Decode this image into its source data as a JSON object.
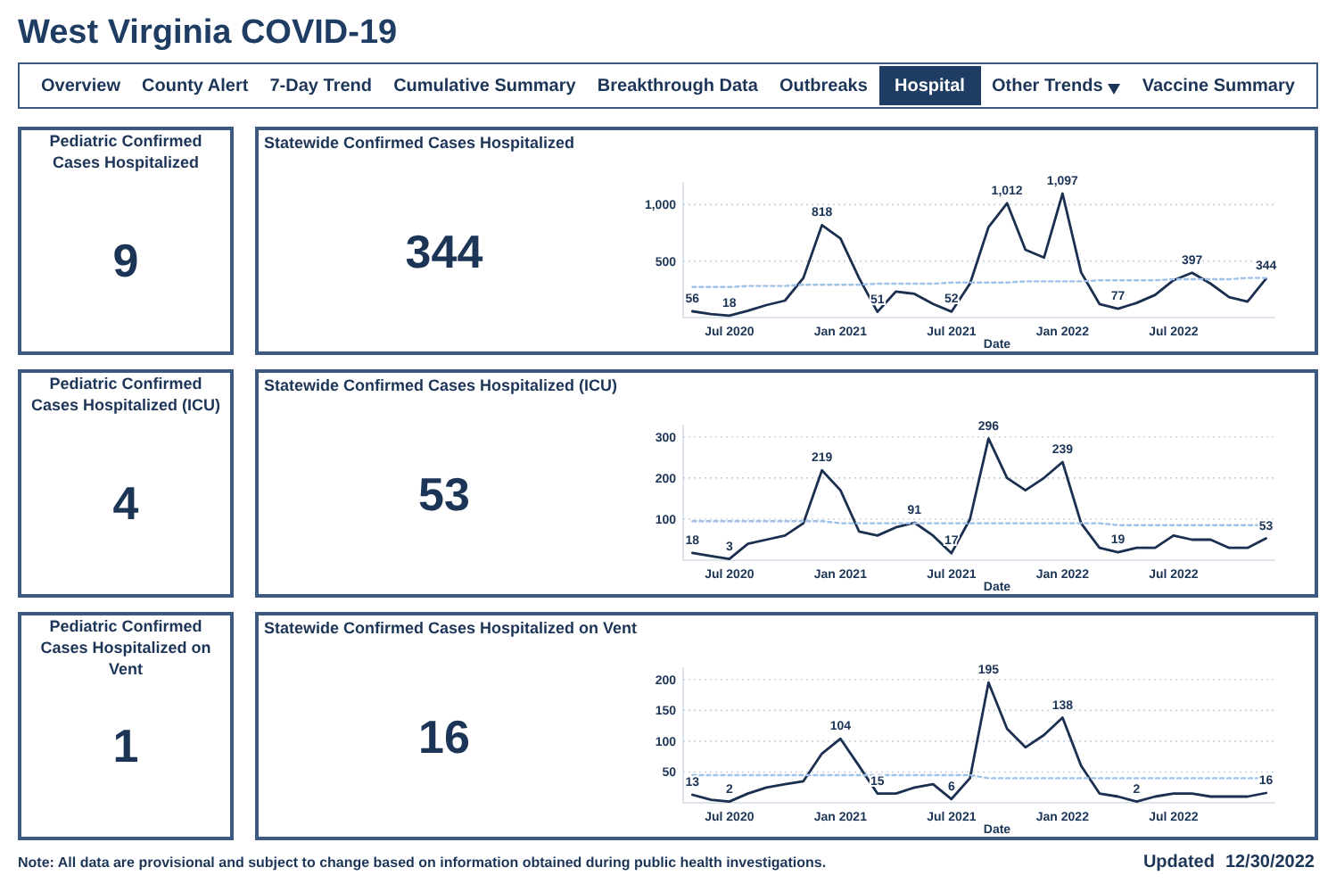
{
  "title": "West Virginia COVID-19",
  "nav": [
    {
      "label": "Overview",
      "selected": false,
      "dropdown": false
    },
    {
      "label": "County Alert",
      "selected": false,
      "dropdown": false
    },
    {
      "label": "7-Day Trend",
      "selected": false,
      "dropdown": false
    },
    {
      "label": "Cumulative Summary",
      "selected": false,
      "dropdown": false
    },
    {
      "label": "Breakthrough Data",
      "selected": false,
      "dropdown": false
    },
    {
      "label": "Outbreaks",
      "selected": false,
      "dropdown": false
    },
    {
      "label": "Hospital",
      "selected": true,
      "dropdown": false
    },
    {
      "label": "Other Trends",
      "selected": false,
      "dropdown": true
    },
    {
      "label": "Vaccine Summary",
      "selected": false,
      "dropdown": false
    }
  ],
  "rows": [
    {
      "pediatric": {
        "label": "Pediatric Confirmed Cases Hospitalized",
        "value": "9"
      },
      "statewide": {
        "label": "Statewide Confirmed Cases Hospitalized",
        "value": "344",
        "chart_data": {
          "type": "line",
          "xlabel": "Date",
          "grid": true,
          "categories": [
            null,
            null,
            "Jul 2020",
            null,
            null,
            null,
            null,
            null,
            "Jan 2021",
            null,
            null,
            null,
            null,
            null,
            "Jul 2021",
            null,
            null,
            null,
            null,
            null,
            "Jan 2022",
            null,
            null,
            null,
            null,
            null,
            "Jul 2022",
            null,
            null,
            null,
            null,
            null
          ],
          "ylim": [
            0,
            1200
          ],
          "yticks": [
            {
              "value": 500,
              "label": "500"
            },
            {
              "value": 1000,
              "label": "1,000"
            }
          ],
          "series": [
            {
              "color": "#1b2f50",
              "line_style": "solid",
              "values": [
                56,
                30,
                18,
                60,
                110,
                150,
                350,
                818,
                700,
                350,
                51,
                230,
                210,
                120,
                52,
                300,
                800,
                1012,
                600,
                530,
                1097,
                400,
                120,
                77,
                130,
                200,
                330,
                397,
                300,
                180,
                140,
                344
              ],
              "value_labels": [
                "56",
                null,
                "18",
                null,
                null,
                null,
                null,
                "818",
                null,
                null,
                "51",
                null,
                null,
                null,
                "52",
                null,
                null,
                "1,012",
                null,
                null,
                "1,097",
                null,
                null,
                "77",
                null,
                null,
                null,
                "397",
                null,
                null,
                null,
                "344"
              ]
            },
            {
              "color": "#9fc0e8",
              "line_style": "dashed",
              "values": [
                270,
                270,
                270,
                280,
                280,
                280,
                290,
                290,
                290,
                290,
                300,
                300,
                300,
                300,
                310,
                310,
                310,
                310,
                320,
                320,
                320,
                320,
                330,
                330,
                330,
                330,
                340,
                340,
                340,
                340,
                350,
                350
              ]
            }
          ]
        }
      }
    },
    {
      "pediatric": {
        "label": "Pediatric Confirmed Cases Hospitalized (ICU)",
        "value": "4"
      },
      "statewide": {
        "label": "Statewide Confirmed Cases Hospitalized (ICU)",
        "value": "53",
        "chart_data": {
          "type": "line",
          "xlabel": "Date",
          "grid": true,
          "categories": [
            null,
            null,
            "Jul 2020",
            null,
            null,
            null,
            null,
            null,
            "Jan 2021",
            null,
            null,
            null,
            null,
            null,
            "Jul 2021",
            null,
            null,
            null,
            null,
            null,
            "Jan 2022",
            null,
            null,
            null,
            null,
            null,
            "Jul 2022",
            null,
            null,
            null,
            null,
            null
          ],
          "ylim": [
            0,
            330
          ],
          "yticks": [
            {
              "value": 100,
              "label": "100"
            },
            {
              "value": 200,
              "label": "200"
            },
            {
              "value": 300,
              "label": "300"
            }
          ],
          "series": [
            {
              "color": "#1b2f50",
              "line_style": "solid",
              "values": [
                18,
                10,
                3,
                40,
                50,
                60,
                90,
                219,
                170,
                70,
                60,
                80,
                91,
                60,
                17,
                100,
                296,
                200,
                170,
                200,
                239,
                90,
                30,
                19,
                30,
                30,
                60,
                50,
                50,
                30,
                30,
                53
              ],
              "value_labels": [
                "18",
                null,
                "3",
                null,
                null,
                null,
                null,
                "219",
                null,
                null,
                null,
                null,
                "91",
                null,
                "17",
                null,
                "296",
                null,
                null,
                null,
                "239",
                null,
                null,
                "19",
                null,
                null,
                null,
                null,
                null,
                null,
                null,
                "53"
              ]
            },
            {
              "color": "#9fc0e8",
              "line_style": "dashed",
              "values": [
                95,
                95,
                95,
                95,
                95,
                95,
                95,
                95,
                90,
                90,
                90,
                90,
                90,
                90,
                90,
                90,
                90,
                90,
                90,
                90,
                90,
                90,
                90,
                85,
                85,
                85,
                85,
                85,
                85,
                85,
                85,
                85
              ]
            }
          ]
        }
      }
    },
    {
      "pediatric": {
        "label": "Pediatric Confirmed Cases Hospitalized on Vent",
        "value": "1"
      },
      "statewide": {
        "label": "Statewide Confirmed Cases Hospitalized on Vent",
        "value": "16",
        "chart_data": {
          "type": "line",
          "xlabel": "Date",
          "grid": true,
          "categories": [
            null,
            null,
            "Jul 2020",
            null,
            null,
            null,
            null,
            null,
            "Jan 2021",
            null,
            null,
            null,
            null,
            null,
            "Jul 2021",
            null,
            null,
            null,
            null,
            null,
            "Jan 2022",
            null,
            null,
            null,
            null,
            null,
            "Jul 2022",
            null,
            null,
            null,
            null,
            null
          ],
          "ylim": [
            0,
            220
          ],
          "yticks": [
            {
              "value": 50,
              "label": "50"
            },
            {
              "value": 100,
              "label": "100"
            },
            {
              "value": 150,
              "label": "150"
            },
            {
              "value": 200,
              "label": "200"
            }
          ],
          "series": [
            {
              "color": "#1b2f50",
              "line_style": "solid",
              "values": [
                13,
                5,
                2,
                15,
                25,
                30,
                35,
                80,
                104,
                60,
                15,
                15,
                25,
                30,
                6,
                40,
                195,
                120,
                90,
                110,
                138,
                60,
                15,
                10,
                2,
                10,
                15,
                15,
                10,
                10,
                10,
                16
              ],
              "value_labels": [
                "13",
                null,
                "2",
                null,
                null,
                null,
                null,
                null,
                "104",
                null,
                "15",
                null,
                null,
                null,
                "6",
                null,
                "195",
                null,
                null,
                null,
                "138",
                null,
                null,
                null,
                "2",
                null,
                null,
                null,
                null,
                null,
                null,
                "16"
              ]
            },
            {
              "color": "#9fc0e8",
              "line_style": "dashed",
              "values": [
                45,
                45,
                45,
                45,
                45,
                45,
                45,
                45,
                45,
                45,
                45,
                45,
                45,
                45,
                45,
                45,
                40,
                40,
                40,
                40,
                40,
                40,
                40,
                40,
                40,
                40,
                40,
                40,
                40,
                40,
                40,
                40
              ]
            }
          ]
        }
      }
    }
  ],
  "footer": {
    "note": "Note: All data are provisional and subject to change based on information obtained during public health investigations.",
    "updated_label": "Updated",
    "updated_date": "12/30/2022"
  }
}
